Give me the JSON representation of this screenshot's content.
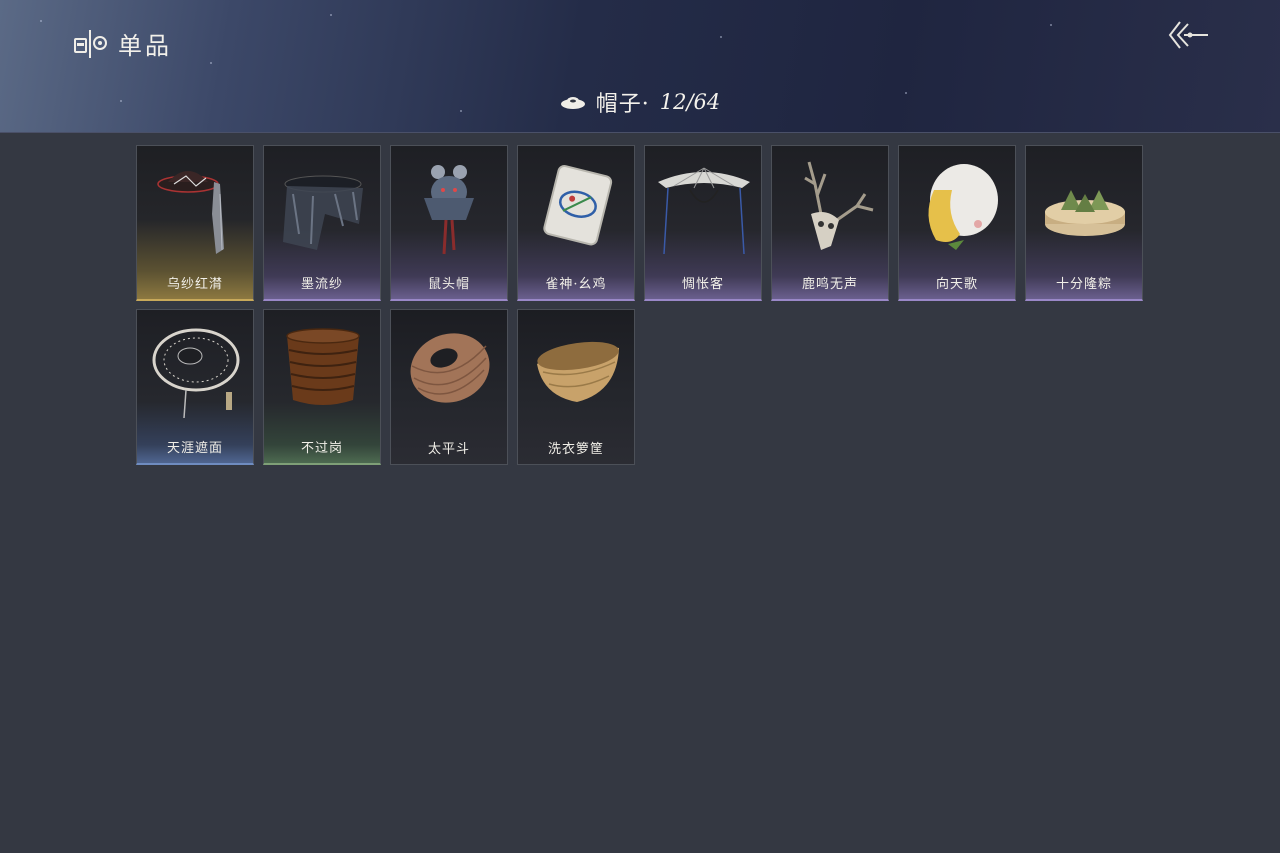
{
  "header": {
    "title": "单品",
    "title_icon": "wardrobe-icon",
    "back_icon": "back-arrow-icon"
  },
  "category": {
    "icon": "hat-icon",
    "label": "帽子·",
    "count": "12/64"
  },
  "items": [
    {
      "name": "乌纱红潸",
      "rarity": "gold"
    },
    {
      "name": "墨流纱",
      "rarity": "purple"
    },
    {
      "name": "鼠头帽",
      "rarity": "purple"
    },
    {
      "name": "雀神·幺鸡",
      "rarity": "purple"
    },
    {
      "name": "惆怅客",
      "rarity": "purple"
    },
    {
      "name": "鹿鸣无声",
      "rarity": "purple"
    },
    {
      "name": "向天歌",
      "rarity": "purple"
    },
    {
      "name": "十分隆粽",
      "rarity": "purple"
    },
    {
      "name": "天涯遮面",
      "rarity": "blue"
    },
    {
      "name": "不过岗",
      "rarity": "green"
    },
    {
      "name": "太平斗",
      "rarity": "none"
    },
    {
      "name": "洗衣箩筐",
      "rarity": "none"
    }
  ],
  "colors": {
    "background": "#343842",
    "gold": "#c8a95a",
    "purple": "#9a88c8",
    "blue": "#6f8cc0",
    "green": "#7fa077"
  }
}
